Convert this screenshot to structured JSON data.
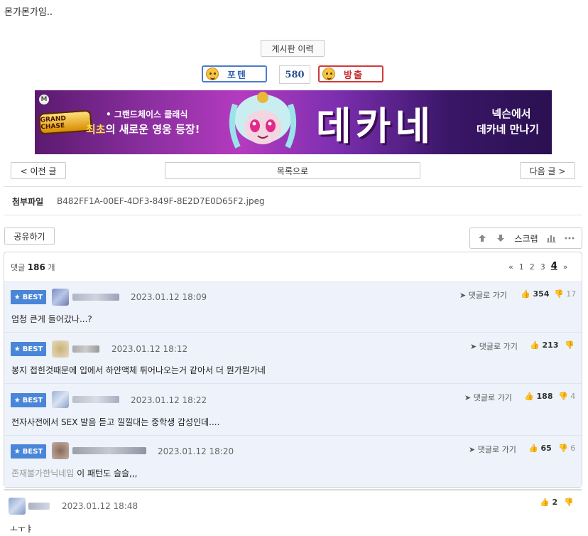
{
  "post": {
    "tail_text": "몬가몬가임.."
  },
  "history_button": "게시판 이력",
  "vote": {
    "potent_label": "포텐",
    "count": "580",
    "banish_label": "방출"
  },
  "ad": {
    "corner_badge": "M",
    "game_logo": "GRAND CHASE",
    "tagline1": "• 그랜드체이스 클래식",
    "tagline2_highlight": "최초",
    "tagline2_rest": "의 새로운 영웅 등장!",
    "hero_name": "데카네",
    "cta_line1": "넥슨에서",
    "cta_line2": "데카네 만나기"
  },
  "nav": {
    "prev": "< 이전 글",
    "list": "목록으로",
    "next": "다음 글 >"
  },
  "attachment": {
    "label": "첨부파일",
    "filename": "B482FF1A-00EF-4DF3-849F-8E2D7E0D65F2.jpeg"
  },
  "share_button": "공유하기",
  "tools": {
    "scrap": "스크랩"
  },
  "comments": {
    "label": "댓글",
    "count": "186",
    "unit": "개",
    "pager": [
      "«",
      "1",
      "2",
      "3",
      "4",
      "»"
    ],
    "best_badge": "BEST",
    "goto_label": "댓글로 가기",
    "best": [
      {
        "date": "2023.01.12 18:09",
        "up": "354",
        "down": "17",
        "text": "엄청 큰게 들어갔나...?"
      },
      {
        "date": "2023.01.12 18:12",
        "up": "213",
        "down": "",
        "text": "봉지 접힌것때문에 입에서 하얀액체 튀어나오는거 같아서 더 뭔가뭔가네"
      },
      {
        "date": "2023.01.12 18:22",
        "up": "188",
        "down": "4",
        "text": "전자사전에서 SEX 발음 듣고 낄낄대는 중학생 감성인데...."
      },
      {
        "date": "2023.01.12 18:20",
        "up": "65",
        "down": "6",
        "text_muted": "존재불가한닉네임",
        "text": "이 패턴도 슬슬,,,"
      }
    ],
    "normal": [
      {
        "date": "2023.01.12 18:48",
        "up": "2",
        "down": "",
        "text": "ㅗㅜㅑ"
      }
    ]
  },
  "colors": {
    "best_bg": "#eef2fa",
    "best_badge": "#4a86d8",
    "potent_border": "#4a7cc9",
    "banish_border": "#d03a3a"
  }
}
